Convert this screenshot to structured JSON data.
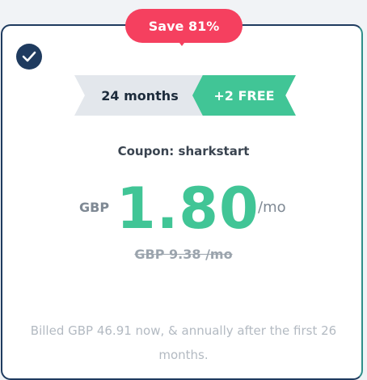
{
  "badge": {
    "label": "Save 81%"
  },
  "plan": {
    "duration": "24 months",
    "bonus": "+2 FREE",
    "coupon": "Coupon: sharkstart"
  },
  "price": {
    "currency": "GBP",
    "amount": "1.80",
    "period": "/mo",
    "original": "GBP 9.38 /mo"
  },
  "billing": {
    "text": "Billed GBP 46.91 now, & annually after the first 26 months."
  },
  "colors": {
    "badge": "#f5405f",
    "accent": "#41c596",
    "check": "#1f3b5f"
  },
  "icons": {
    "selected": "check-icon"
  }
}
